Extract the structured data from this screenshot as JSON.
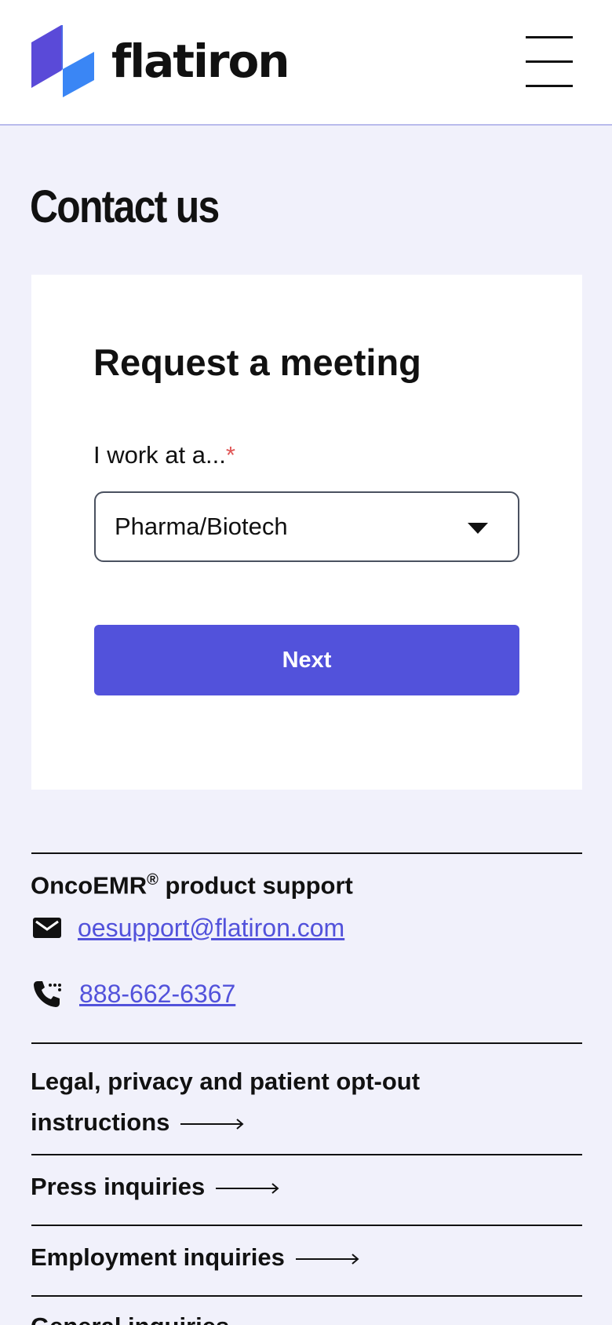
{
  "header": {
    "brand": "flatiron",
    "logo_colors": {
      "top": "#5a4ad8",
      "bottom": "#3a86f5"
    },
    "menu_icon": "hamburger-menu-icon"
  },
  "page": {
    "title": "Contact us"
  },
  "form": {
    "title": "Request a meeting",
    "label": "I work at a...",
    "required_mark": "*",
    "select_value": "Pharma/Biotech",
    "next_label": "Next",
    "accent": "#5252db"
  },
  "support": {
    "heading": "OncoEMR",
    "heading_mark": "®",
    "heading_suffix": " product support",
    "email": "oesupport@flatiron.com",
    "email_icon": "mail-icon",
    "phone": "888-662-6367",
    "phone_icon": "phone-icon"
  },
  "links": [
    {
      "line1": "Legal, privacy and patient opt-out",
      "line2": "instructions"
    },
    {
      "label": "Press inquiries"
    },
    {
      "label": "Employment inquiries"
    },
    {
      "label": "General inquiries"
    }
  ]
}
